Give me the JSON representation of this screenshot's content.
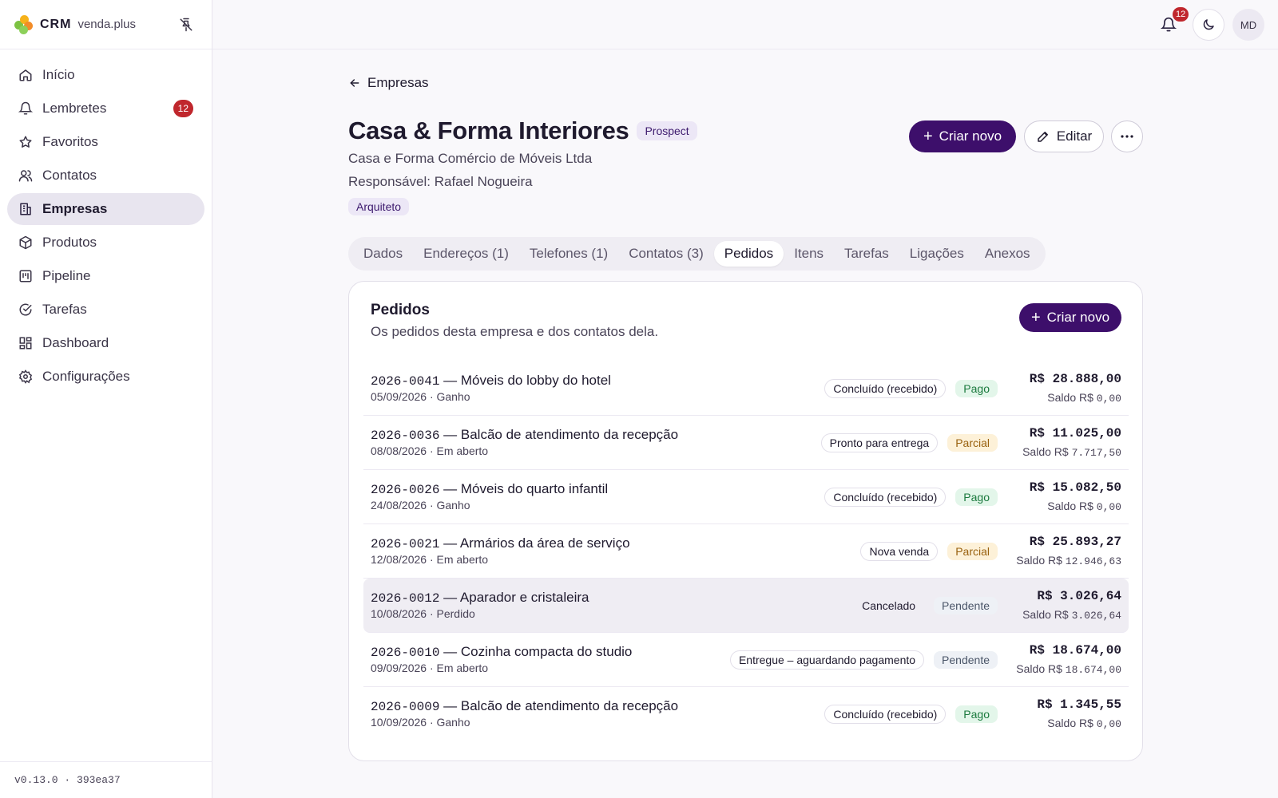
{
  "brand": {
    "name": "CRM",
    "subtitle": "venda.plus"
  },
  "sidebar": {
    "items": [
      {
        "label": "Início",
        "icon": "home-icon"
      },
      {
        "label": "Lembretes",
        "icon": "bell-icon",
        "badge": "12"
      },
      {
        "label": "Favoritos",
        "icon": "star-icon"
      },
      {
        "label": "Contatos",
        "icon": "users-icon"
      },
      {
        "label": "Empresas",
        "icon": "building-icon",
        "active": true
      },
      {
        "label": "Produtos",
        "icon": "package-icon"
      },
      {
        "label": "Pipeline",
        "icon": "kanban-icon"
      },
      {
        "label": "Tarefas",
        "icon": "check-circle-icon"
      },
      {
        "label": "Dashboard",
        "icon": "dashboard-icon"
      },
      {
        "label": "Configurações",
        "icon": "settings-icon"
      }
    ],
    "version": "v0.13.0 · 393ea37"
  },
  "header": {
    "notifications_count": "12",
    "avatar_initials": "MD"
  },
  "breadcrumb": {
    "back_label": "Empresas"
  },
  "company": {
    "name": "Casa & Forma Interiores",
    "status": "Prospect",
    "legal_name": "Casa e Forma Comércio de Móveis Ltda",
    "responsible": "Responsável: Rafael Nogueira",
    "tag": "Arquiteto"
  },
  "actions": {
    "create_label": "Criar novo",
    "edit_label": "Editar"
  },
  "tabs": [
    {
      "label": "Dados"
    },
    {
      "label": "Endereços (1)"
    },
    {
      "label": "Telefones (1)"
    },
    {
      "label": "Contatos (3)"
    },
    {
      "label": "Pedidos",
      "active": true
    },
    {
      "label": "Itens"
    },
    {
      "label": "Tarefas"
    },
    {
      "label": "Ligações"
    },
    {
      "label": "Anexos"
    }
  ],
  "orders_card": {
    "title": "Pedidos",
    "subtitle": "Os pedidos desta empresa e dos contatos dela.",
    "create_label": "Criar novo",
    "orders": [
      {
        "code": "2026-0041",
        "title": " — Móveis do lobby do hotel",
        "meta": "05/09/2026 · Ganho",
        "stage": "Concluído (recebido)",
        "payment": "Pago",
        "amount": "R$ 28.888,00",
        "saldo_label": "Saldo R$ ",
        "saldo": "0,00"
      },
      {
        "code": "2026-0036",
        "title": " — Balcão de atendimento da recepção",
        "meta": "08/08/2026 · Em aberto",
        "stage": "Pronto para entrega",
        "payment": "Parcial",
        "amount": "R$ 11.025,00",
        "saldo_label": "Saldo R$ ",
        "saldo": "7.717,50"
      },
      {
        "code": "2026-0026",
        "title": " — Móveis do quarto infantil",
        "meta": "24/08/2026 · Ganho",
        "stage": "Concluído (recebido)",
        "payment": "Pago",
        "amount": "R$ 15.082,50",
        "saldo_label": "Saldo R$ ",
        "saldo": "0,00"
      },
      {
        "code": "2026-0021",
        "title": " — Armários da área de serviço",
        "meta": "12/08/2026 · Em aberto",
        "stage": "Nova venda",
        "payment": "Parcial",
        "amount": "R$ 25.893,27",
        "saldo_label": "Saldo R$ ",
        "saldo": "12.946,63"
      },
      {
        "code": "2026-0012",
        "title": " — Aparador e cristaleira",
        "meta": "10/08/2026 · Perdido",
        "stage": "Cancelado",
        "payment": "Pendente",
        "amount": "R$ 3.026,64",
        "saldo_label": "Saldo R$ ",
        "saldo": "3.026,64"
      },
      {
        "code": "2026-0010",
        "title": " — Cozinha compacta do studio",
        "meta": "09/09/2026 · Em aberto",
        "stage": "Entregue – aguardando pagamento",
        "payment": "Pendente",
        "amount": "R$ 18.674,00",
        "saldo_label": "Saldo R$ ",
        "saldo": "18.674,00"
      },
      {
        "code": "2026-0009",
        "title": " — Balcão de atendimento da recepção",
        "meta": "10/09/2026 · Ganho",
        "stage": "Concluído (recebido)",
        "payment": "Pago",
        "amount": "R$ 1.345,55",
        "saldo_label": "Saldo R$ ",
        "saldo": "0,00"
      }
    ]
  },
  "colors": {
    "primary": "#3d0f6b",
    "badge_red": "#c0272d",
    "pago_bg": "#e3f6ea",
    "pago_fg": "#1b7a3e",
    "parcial_bg": "#fdf1d8",
    "parcial_fg": "#9a6210",
    "pendente_bg": "#eef1f6",
    "pendente_fg": "#4a5568"
  }
}
